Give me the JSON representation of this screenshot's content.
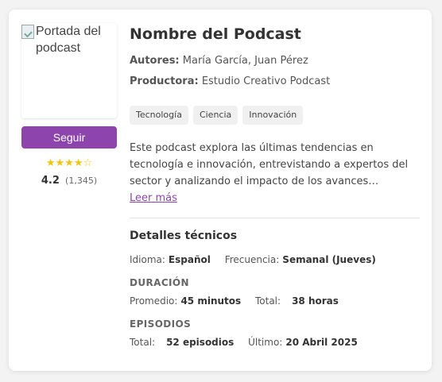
{
  "cover": {
    "alt": "Portada del podcast"
  },
  "follow_label": "Seguir",
  "rating": {
    "stars_full": 4,
    "stars_total": 5,
    "value": "4.2",
    "count": "(1,345)"
  },
  "title": "Nombre del Podcast",
  "authors": {
    "label": "Autores:",
    "value": "María García, Juan Pérez"
  },
  "producer": {
    "label": "Productora:",
    "value": "Estudio Creativo Podcast"
  },
  "tags": [
    "Tecnología",
    "Ciencia",
    "Innovación"
  ],
  "description": "Este podcast explora las últimas tendencias en tecnología e innovación, entrevistando a expertos del sector y analizando el impacto de los avances tecnológicos en la sociedad.",
  "read_more": "Leer más",
  "technical": {
    "heading": "Detalles técnicos",
    "language": {
      "label": "Idioma:",
      "value": "Español"
    },
    "frequency": {
      "label": "Frecuencia:",
      "value": "Semanal (Jueves)"
    }
  },
  "duration": {
    "heading": "DURACIÓN",
    "average": {
      "label": "Promedio:",
      "value": "45 minutos"
    },
    "total": {
      "label": "Total:",
      "value": "38 horas"
    }
  },
  "episodes": {
    "heading": "EPISODIOS",
    "total": {
      "label": "Total:",
      "value": "52 episodios"
    },
    "last": {
      "label": "Último:",
      "value": "20 Abril 2025"
    }
  },
  "colors": {
    "accent": "#8e44ad",
    "star": "#f1c40f"
  }
}
